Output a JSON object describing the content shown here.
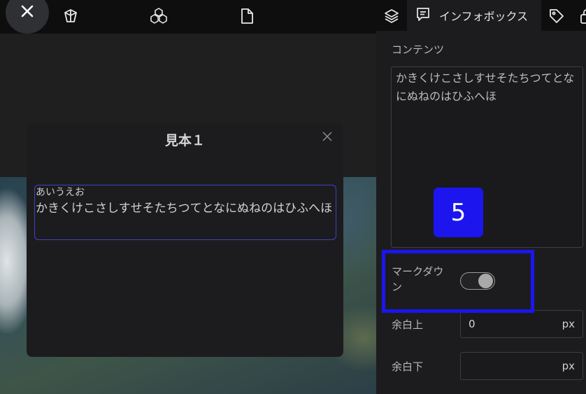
{
  "toolbar": {
    "icons": [
      "close-icon",
      "cube-icon",
      "cubes-icon",
      "file-icon",
      "layers-icon",
      "infobox-icon",
      "tag-icon",
      "lock-icon"
    ],
    "active_tab_label": "インフォボックス"
  },
  "modal": {
    "title": "見本１",
    "preview_title": "あいうえお",
    "preview_body": "かきくけこさしすせそたちつてとなにぬねのはひふへほ"
  },
  "panel": {
    "content_label": "コンテンツ",
    "content_value": "かきくけこさしすせそたちつてとなにぬねのはひふへほ",
    "markdown_label": "マークダウン",
    "markdown_enabled": true,
    "padding_top_label": "余白上",
    "padding_top_value": "0",
    "padding_bottom_label": "余白下",
    "padding_bottom_value": "",
    "unit": "px"
  },
  "annotation": {
    "step_number": "5",
    "color": "#1c15ee"
  }
}
